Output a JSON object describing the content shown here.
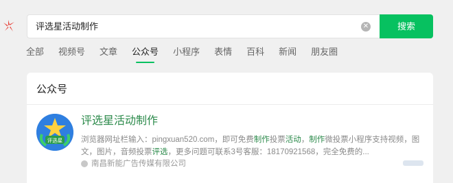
{
  "search": {
    "query": "评选星活动制作",
    "button_label": "搜索"
  },
  "tabs": [
    {
      "label": "全部"
    },
    {
      "label": "视频号"
    },
    {
      "label": "文章"
    },
    {
      "label": "公众号"
    },
    {
      "label": "小程序"
    },
    {
      "label": "表情"
    },
    {
      "label": "百科"
    },
    {
      "label": "新闻"
    },
    {
      "label": "朋友圈"
    }
  ],
  "section": {
    "title": "公众号"
  },
  "result": {
    "title": "评选星活动制作",
    "snippet_parts": [
      "浏览器网址栏输入：pingxuan520.com，即可免费",
      "制作",
      "投票",
      "活动",
      "，",
      "制作",
      "微投票小程序支持视频，图文，图片，音频投票",
      "评选",
      "，更多问题可联系3号客服：18170921568，完全免费的..."
    ],
    "source": "南昌新能广告传媒有限公司",
    "avatar_text": "评选星"
  },
  "colors": {
    "accent": "#07c160",
    "highlight": "#2c8a4b"
  }
}
